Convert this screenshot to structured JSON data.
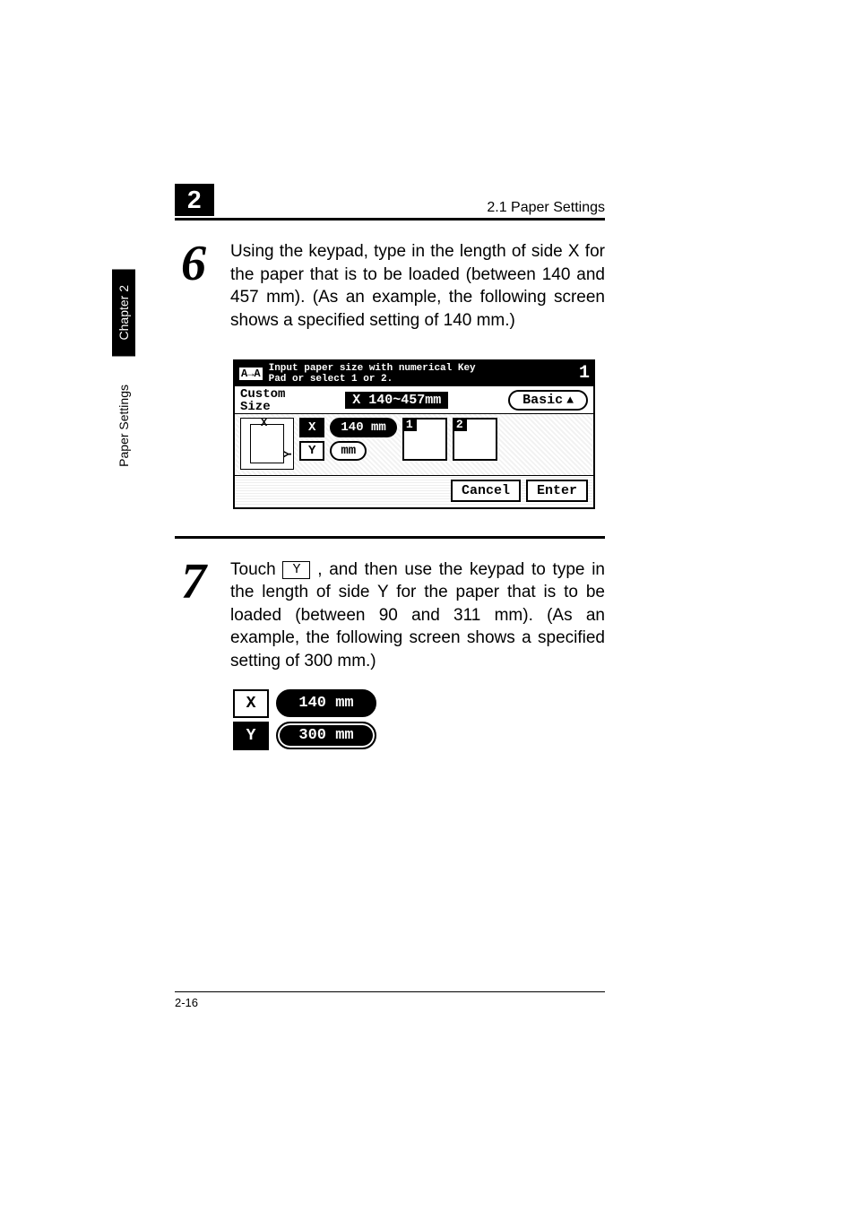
{
  "header": {
    "chapter_badge": "2",
    "section_title": "2.1 Paper Settings"
  },
  "side_tabs": {
    "dark": "Chapter 2",
    "light": "Paper Settings"
  },
  "steps": {
    "s6": {
      "num": "6",
      "text": "Using the keypad, type in the length of side X for the paper that is to be loaded (between 140 and 457 mm). (As an example, the following screen shows a specified setting of 140 mm.)"
    },
    "s7": {
      "num": "7",
      "pre": "Touch ",
      "key": "Y",
      "post": " , and then use the keypad to type in the length of side Y for the paper that is to be loaded (between 90 and 311 mm). (As an example, the following screen shows a specified setting of 300 mm.)"
    }
  },
  "lcd": {
    "topbar_icon": "A→A",
    "topbar_line1": "Input paper size with numerical Key",
    "topbar_line2": "Pad or select 1 or 2.",
    "corner_index": "1",
    "custom_label_line1": "Custom",
    "custom_label_line2": "Size",
    "range_label": "X 140~457mm",
    "basic_label": "Basic",
    "paper_x_mark": "X",
    "paper_y_mark": "Y",
    "row_x": {
      "letter": "X",
      "value": "140 mm"
    },
    "row_y": {
      "letter": "Y",
      "value": "mm"
    },
    "mem1": "1",
    "mem2": "2",
    "cancel": "Cancel",
    "enter": "Enter"
  },
  "xy_panel": {
    "x_letter": "X",
    "x_value": "140 mm",
    "y_letter": "Y",
    "y_value": "300 mm"
  },
  "footer": {
    "page_num": "2-16"
  }
}
